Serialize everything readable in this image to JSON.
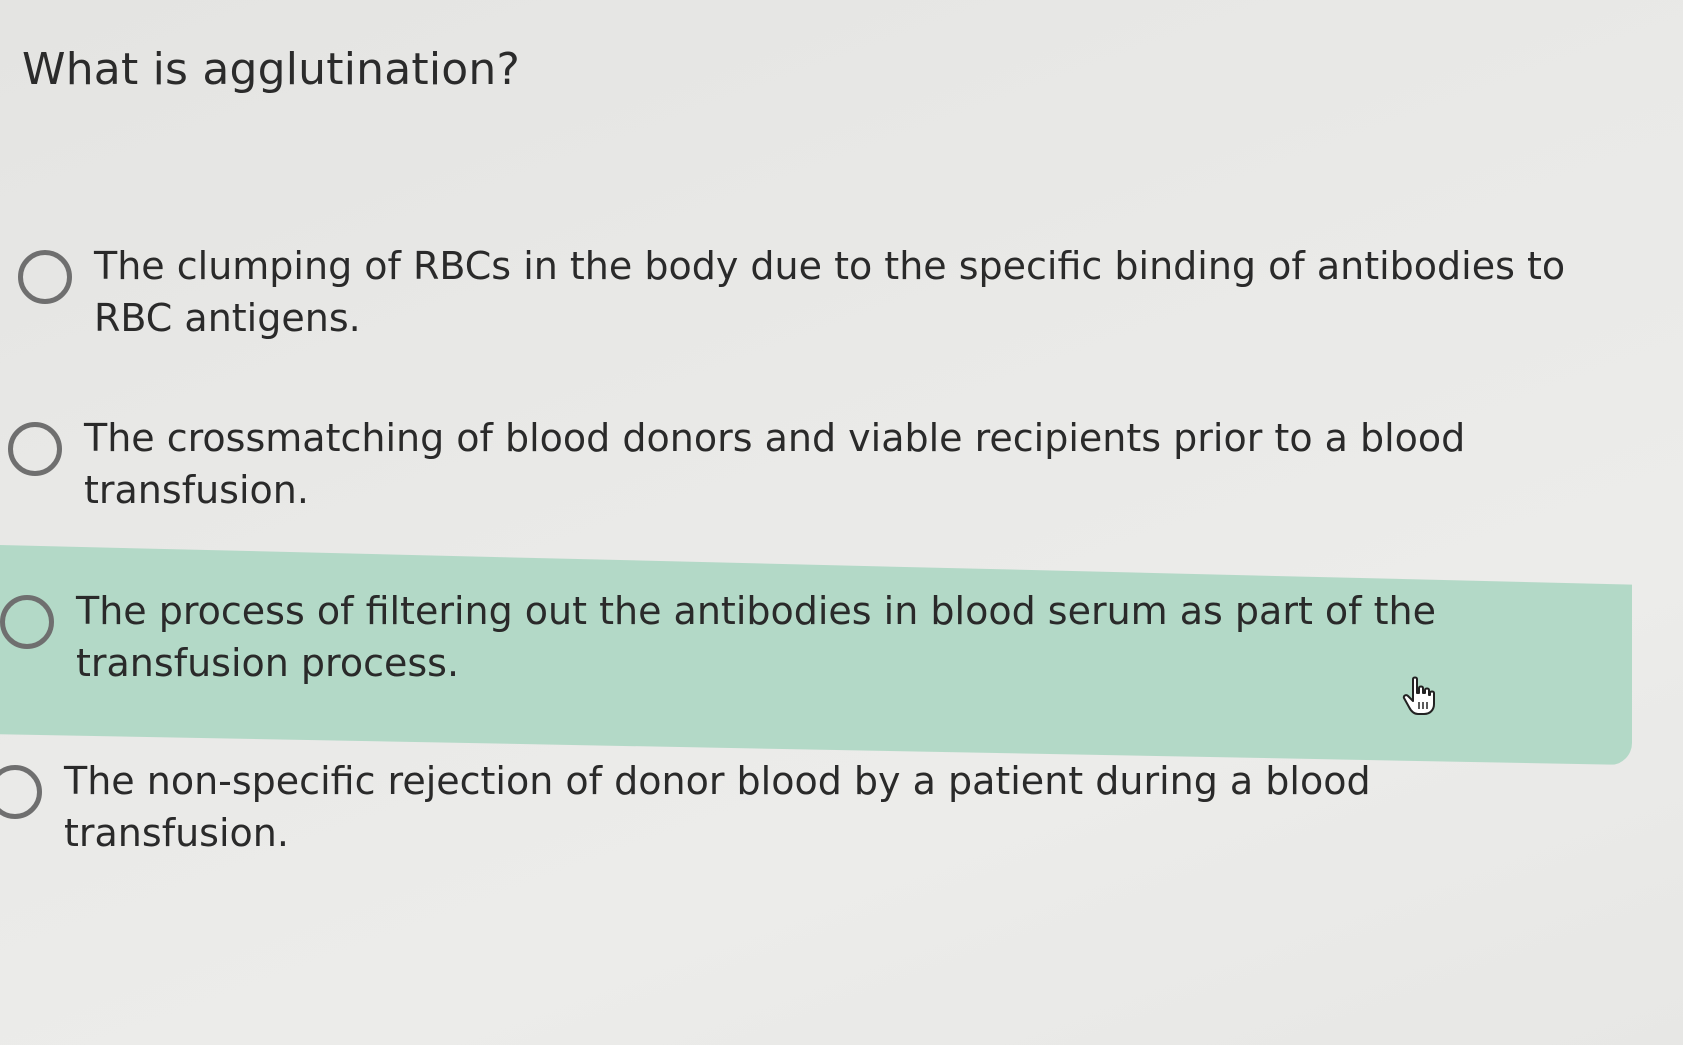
{
  "question": {
    "text": "What is agglutination?"
  },
  "options": [
    {
      "label": "The clumping of RBCs in the body due to the specific binding of antibodies to RBC antigens.",
      "selected": false,
      "highlighted": false
    },
    {
      "label": "The crossmatching of blood donors and viable recipients prior to a blood transfusion.",
      "selected": false,
      "highlighted": false
    },
    {
      "label": "The process of filtering out the antibodies in blood serum as part of the transfusion process.",
      "selected": false,
      "highlighted": true
    },
    {
      "label": "The non-specific rejection of donor blood by a patient during a blood transfusion.",
      "selected": false,
      "highlighted": false
    }
  ],
  "colors": {
    "highlight": "#a9d6c1",
    "background": "#e8e8e6",
    "radio_border": "#6f6f6f"
  },
  "icons": {
    "cursor": "hand-pointer-icon"
  }
}
